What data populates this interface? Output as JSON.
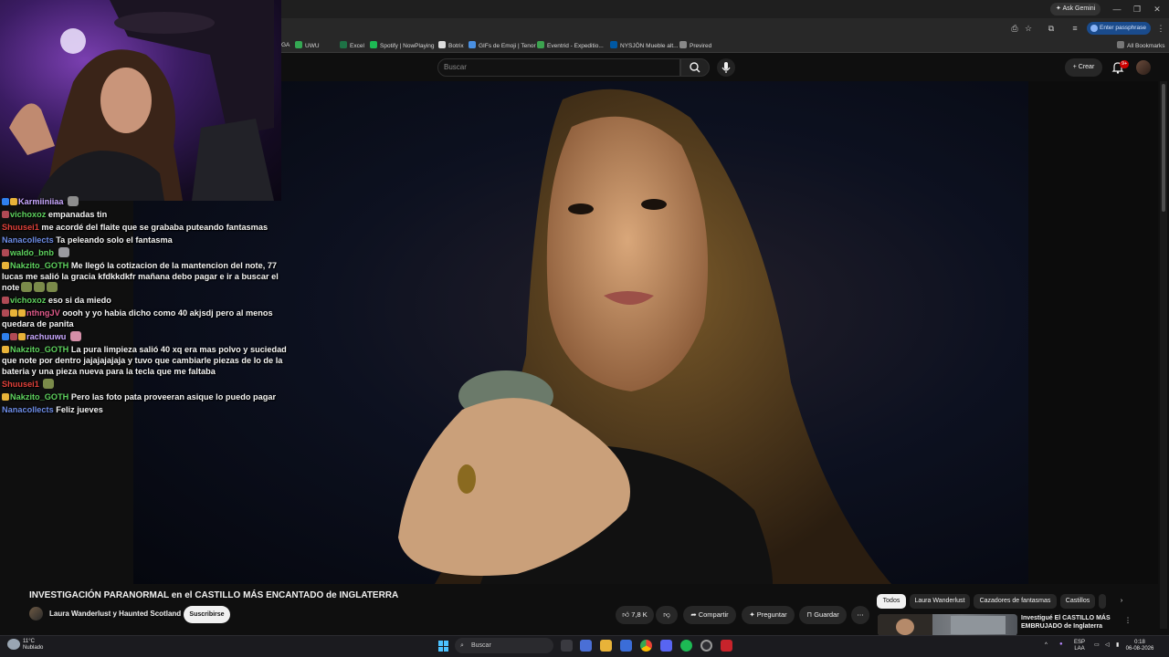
{
  "browser": {
    "gemini_label": "Ask Gemini",
    "passphrase_label": "Enter passphrase",
    "all_bookmarks": "All Bookmarks",
    "bookmarks": [
      {
        "label": "GA",
        "color": "#888888"
      },
      {
        "label": "UWU",
        "color": "#34a853"
      },
      {
        "label": "Excel",
        "color": "#1e7145"
      },
      {
        "label": "Spotify | NowPlaying",
        "color": "#1db954"
      },
      {
        "label": "Botrix",
        "color": "#dddddd"
      },
      {
        "label": "GIFs de Emoji | Tenor",
        "color": "#4a90e2"
      },
      {
        "label": "Eventrid - Expeditio...",
        "color": "#3ca34f"
      },
      {
        "label": "NYSJÖN Mueble alt...",
        "color": "#0058a3"
      },
      {
        "label": "Previred",
        "color": "#888888"
      }
    ]
  },
  "youtube": {
    "search_placeholder": "Buscar",
    "create_label": "Crear",
    "notif_count": "9+",
    "video_title": "INVESTIGACIÓN PARANORMAL en el CASTILLO MÁS ENCANTADO de INGLATERRA",
    "channel_name": "Laura Wanderlust y Haunted Scotland",
    "subscribe_label": "Suscribirse",
    "like_count": "7,8 K",
    "share_label": "Compartir",
    "ask_label": "Preguntar",
    "save_label": "Guardar",
    "chips": [
      "Todos",
      "Laura Wanderlust",
      "Cazadores de fantasmas",
      "Castillos"
    ],
    "recommended_title": "Investigué El CASTILLO MÁS EMBRUJADO de Inglaterra"
  },
  "chat": [
    {
      "user": "Karmiiniiaa",
      "color": "#c9a8ff",
      "text": "",
      "badges": [
        "#2f80ed",
        "#e8b339"
      ],
      "emotes": [
        "#8d8d8d"
      ]
    },
    {
      "user": "vichoxoz",
      "color": "#5fd35f",
      "text": "empanadas tin",
      "badges": [
        "#b04a55"
      ],
      "emotes": []
    },
    {
      "user": "Shuusei1",
      "color": "#e0413a",
      "text": "me acordé del flaite que se grababa puteando fantasmas",
      "badges": [],
      "emotes": []
    },
    {
      "user": "Nanacollects",
      "color": "#6e8de6",
      "text": "Ta peleando solo el fantasma",
      "badges": [],
      "emotes": []
    },
    {
      "user": "waldo_bnb",
      "color": "#5fd35f",
      "text": "",
      "badges": [
        "#b04a55"
      ],
      "emotes": [
        "#9a9aa0"
      ]
    },
    {
      "user": "Nakzito_GOTH",
      "color": "#5fd35f",
      "text": "Me llegó la cotizacion de la mantencion del note, 77 lucas me salió la gracia kfdkkdkfr mañana debo pagar e ir a buscar el note",
      "badges": [
        "#e8b339"
      ],
      "emotes": [
        "#7a8a4a",
        "#7a8a4a",
        "#7a8a4a"
      ]
    },
    {
      "user": "vichoxoz",
      "color": "#5fd35f",
      "text": "eso si da miedo",
      "badges": [
        "#b04a55"
      ],
      "emotes": []
    },
    {
      "user": "nthngJV",
      "color": "#e05a8a",
      "text": "oooh y yo habia dicho como 40 akjsdj pero al menos quedara de panita",
      "badges": [
        "#b04a55",
        "#e8b339",
        "#e8b339"
      ],
      "emotes": []
    },
    {
      "user": "rachuuwu",
      "color": "#c9a8ff",
      "text": "",
      "badges": [
        "#2f80ed",
        "#b04a55",
        "#e8b339"
      ],
      "emotes": [
        "#d58fa8"
      ]
    },
    {
      "user": "Nakzito_GOTH",
      "color": "#5fd35f",
      "text": "La pura limpieza salió 40 xq era mas polvo y suciedad que note por dentro jajajajajaja y tuvo que cambiarle piezas de lo de la bateria y una pieza nueva para la tecla que me faltaba",
      "badges": [
        "#e8b339"
      ],
      "emotes": []
    },
    {
      "user": "Shuusei1",
      "color": "#e0413a",
      "text": "",
      "badges": [],
      "emotes": [
        "#7a8a4a"
      ]
    },
    {
      "user": "Nakzito_GOTH",
      "color": "#5fd35f",
      "text": "Pero las foto pata proveeran asique lo puedo pagar",
      "badges": [
        "#e8b339"
      ],
      "emotes": []
    },
    {
      "user": "Nanacollects",
      "color": "#6e8de6",
      "text": "Feliz jueves",
      "badges": [],
      "emotes": []
    }
  ],
  "taskbar": {
    "temp": "11°C",
    "weather": "Nublado",
    "search_placeholder": "Buscar",
    "lang1": "ESP",
    "lang2": "LAA",
    "time": "0:18",
    "date": "06-08-2026"
  }
}
